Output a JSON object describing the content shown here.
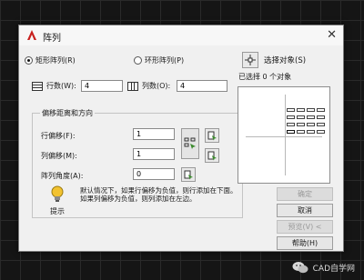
{
  "dialog": {
    "title": "阵列",
    "close_glyph": "✕"
  },
  "layout_type": {
    "rect_label": "矩形阵列(R)",
    "polar_label": "环形阵列(P)",
    "selected": "rect"
  },
  "counts": {
    "rows_label": "行数(W):",
    "rows_value": "4",
    "cols_label": "列数(O):",
    "cols_value": "4"
  },
  "offset_group": {
    "title": "偏移距离和方向",
    "row_offset_label": "行偏移(F):",
    "row_offset_value": "1",
    "col_offset_label": "列偏移(M):",
    "col_offset_value": "1",
    "angle_label": "阵列角度(A):",
    "angle_value": "0"
  },
  "tip": {
    "label": "提示",
    "text": "默认情况下，如果行偏移为负值，则行添加在下面。如果列偏移为负值，则列添加在左边。"
  },
  "selection": {
    "button_label": "选择对象(S)",
    "status": "已选择 0 个对象"
  },
  "buttons": {
    "ok": "确定",
    "cancel": "取消",
    "preview": "预览(V) <",
    "help": "帮助(H)"
  },
  "watermark": {
    "text": "CAD自学网"
  },
  "colors": {
    "accent_red": "#c8201e",
    "tip_yellow": "#f2c230",
    "pick_green": "#3a8a2c"
  },
  "icons": {
    "app": "autocad-a-icon",
    "rows": "rows-icon",
    "cols": "cols-icon",
    "select": "crosshair-select-icon",
    "pick_both": "pick-both-offsets-icon",
    "pick_single": "pick-point-icon",
    "tip": "lightbulb-icon",
    "wechat": "wechat-icon"
  }
}
